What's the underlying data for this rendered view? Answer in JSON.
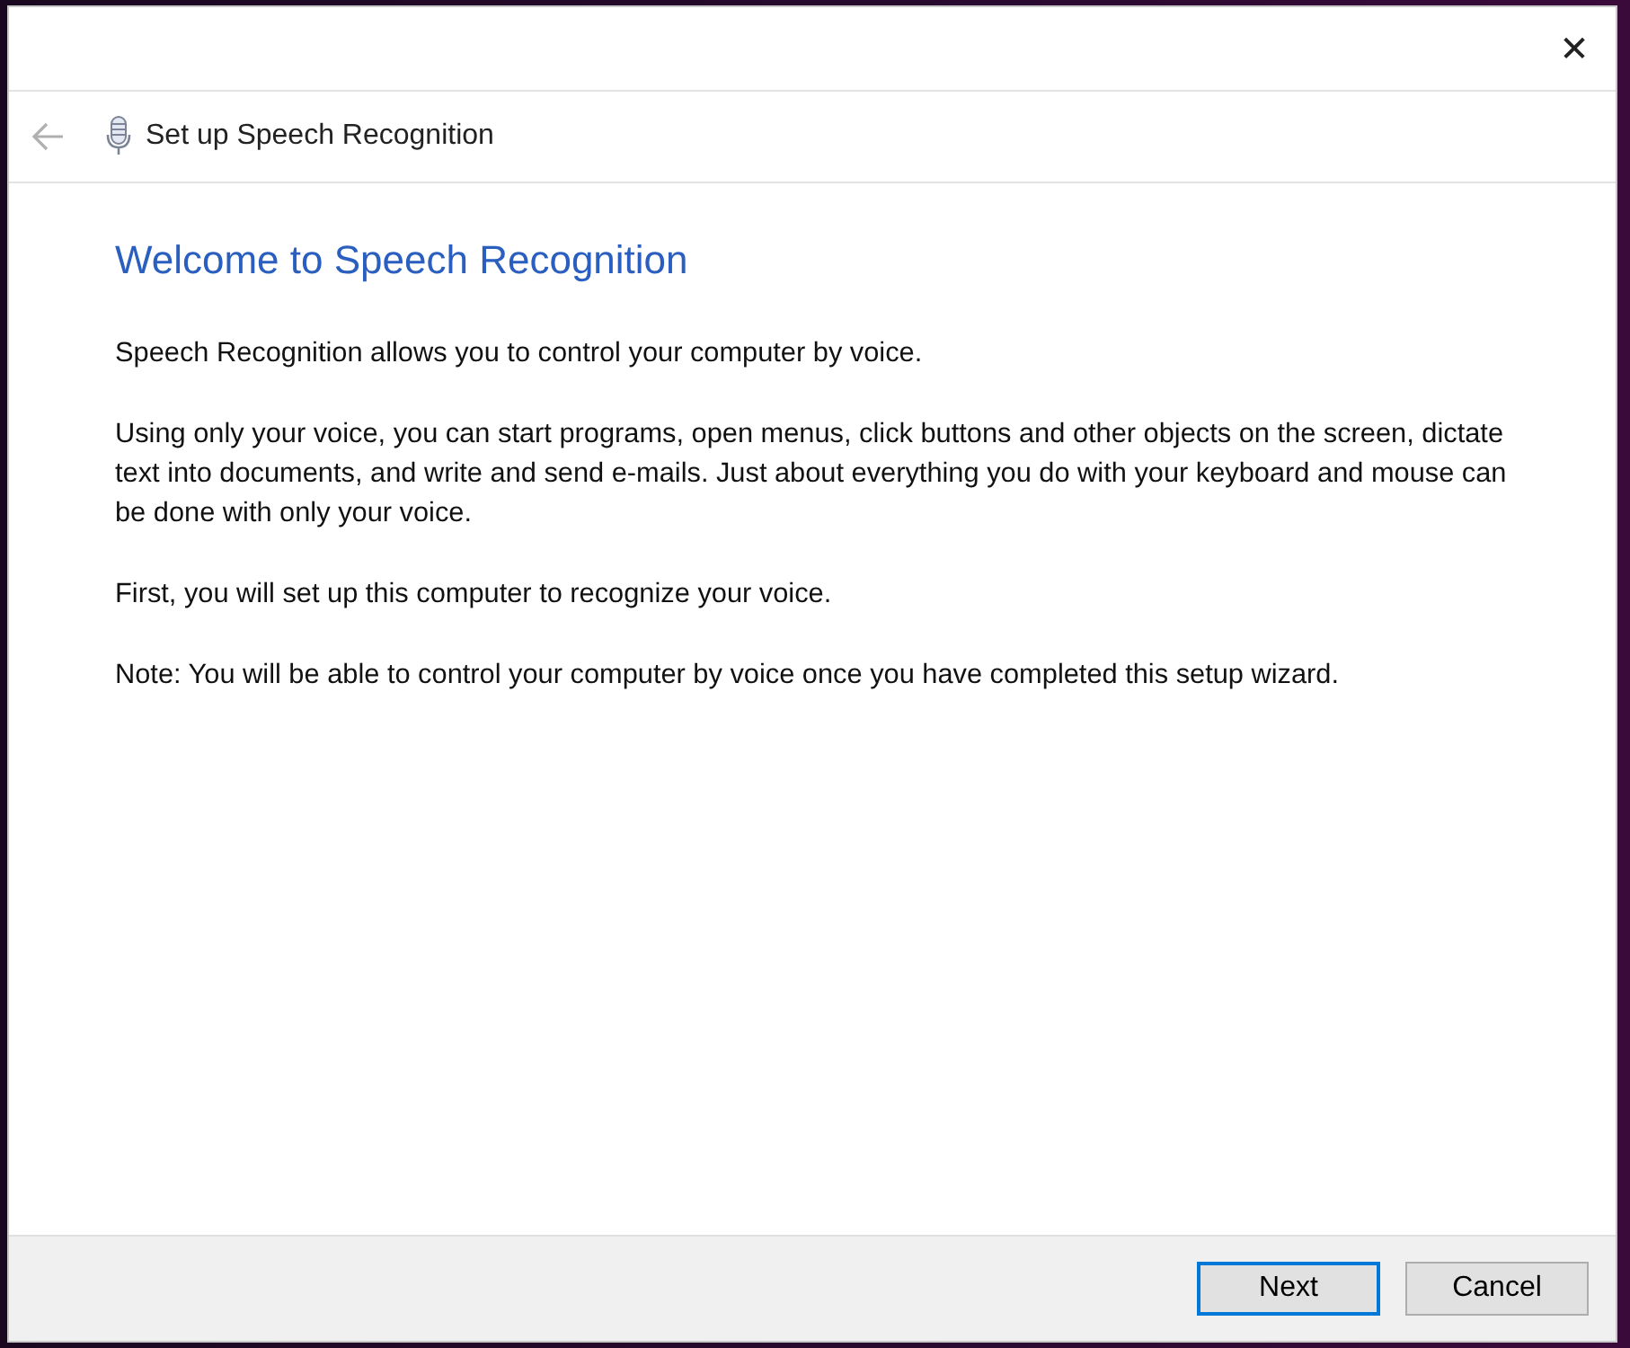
{
  "window": {
    "close_symbol": "✕"
  },
  "header": {
    "back_disabled": true,
    "title": "Set up Speech Recognition"
  },
  "heading": "Welcome to Speech Recognition",
  "paragraphs": [
    "Speech Recognition allows you to control your computer by voice.",
    "Using only your voice, you can start programs, open menus, click buttons and other objects on the screen, dictate text into documents, and write and send e-mails. Just about everything you do with your keyboard and mouse can be done with only your voice.",
    "First, you will set up this computer to recognize your voice.",
    "Note: You will be able to control your computer by voice once you have completed this setup wizard."
  ],
  "buttons": [
    {
      "label": "Next",
      "default": true
    },
    {
      "label": "Cancel",
      "default": false
    }
  ]
}
